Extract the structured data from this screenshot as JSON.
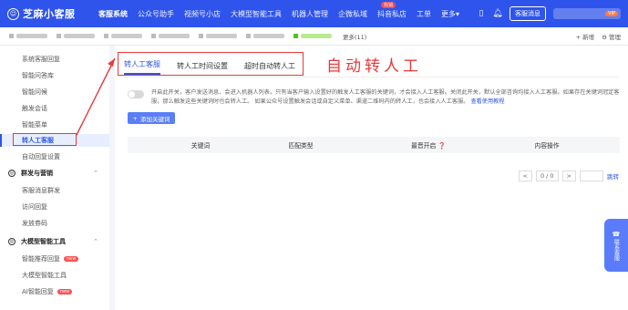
{
  "brand": {
    "name": "芝麻小客服"
  },
  "topnav": {
    "items": [
      "客服系统",
      "公众号助手",
      "视频号小店",
      "大模型智能工具",
      "机器人管理",
      "企微私域",
      "抖音私店",
      "工单",
      "更多"
    ],
    "hot_badge": "热销",
    "more_label": "更多▾",
    "message_button": "客服消息",
    "vip": "VIP"
  },
  "tabsbar": {
    "more": "更多(11)",
    "add": "+ 新增",
    "manage": "⚙ 管理"
  },
  "sidebar": {
    "items": [
      {
        "label": "系统客服回复",
        "type": "item"
      },
      {
        "label": "智能问答库",
        "type": "item"
      },
      {
        "label": "智能问候",
        "type": "item"
      },
      {
        "label": "触发会话",
        "type": "item"
      },
      {
        "label": "智能菜单",
        "type": "item"
      },
      {
        "label": "转人工客服",
        "type": "item",
        "active": true
      },
      {
        "label": "自动回复设置",
        "type": "item"
      },
      {
        "label": "群发与营销",
        "type": "group"
      },
      {
        "label": "客服消息群发",
        "type": "item"
      },
      {
        "label": "访问回复",
        "type": "item"
      },
      {
        "label": "发放券码",
        "type": "item"
      },
      {
        "label": "大模型智能工具",
        "type": "group"
      },
      {
        "label": "智能推荐回复",
        "type": "item",
        "tag": "new"
      },
      {
        "label": "大模型智能工具",
        "type": "item"
      },
      {
        "label": "AI智能回复",
        "type": "item",
        "tag": "new"
      }
    ]
  },
  "main": {
    "tabs": [
      "转人工客服",
      "转人工时间设置",
      "超时自动转人工"
    ],
    "annotation": "自动转人工",
    "notice": "开启此开关，客户发送消息、会进入机器人列表，只有当客户输入设置好的触发人工客服的关键词，才会接入人工客服。关闭此开关，默认全部咨询均接入人工客服。如果存在关键词冠定客服，那么触发这些关键词时也会转人工。 如果公众号设置触发会话或自定义菜单、渠道二维码内的转人工，也会接入人工客服。",
    "notice_link": "查看使用教程",
    "add_button": "添加关键词",
    "table_headers": [
      "关键词",
      "匹配类型",
      "最晋开启 ❓",
      "内容操作"
    ],
    "pager": {
      "prev": "<",
      "page": "0 / 0",
      "next": ">",
      "jump": "跳转"
    }
  },
  "float_service": {
    "label": "联系客服"
  }
}
